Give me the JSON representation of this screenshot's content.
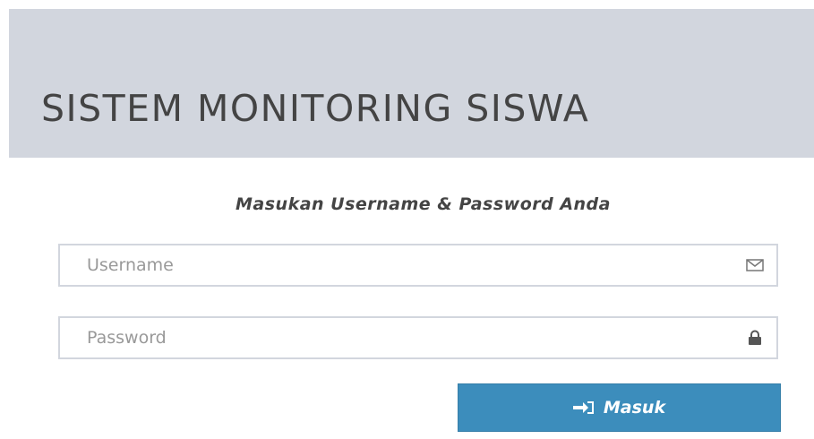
{
  "header": {
    "title": "SISTEM MONITORING SISWA"
  },
  "login": {
    "message": "Masukan Username & Password Anda",
    "username": {
      "placeholder": "Username",
      "value": "",
      "icon": "envelope-icon"
    },
    "password": {
      "placeholder": "Password",
      "value": "",
      "icon": "lock-icon"
    },
    "submit": {
      "label": "Masuk",
      "icon": "sign-in-icon"
    }
  },
  "colors": {
    "header_background": "#d2d6de",
    "title_text": "#444444",
    "input_border": "#d2d6de",
    "button_background": "#3c8dbc",
    "button_text": "#ffffff"
  }
}
